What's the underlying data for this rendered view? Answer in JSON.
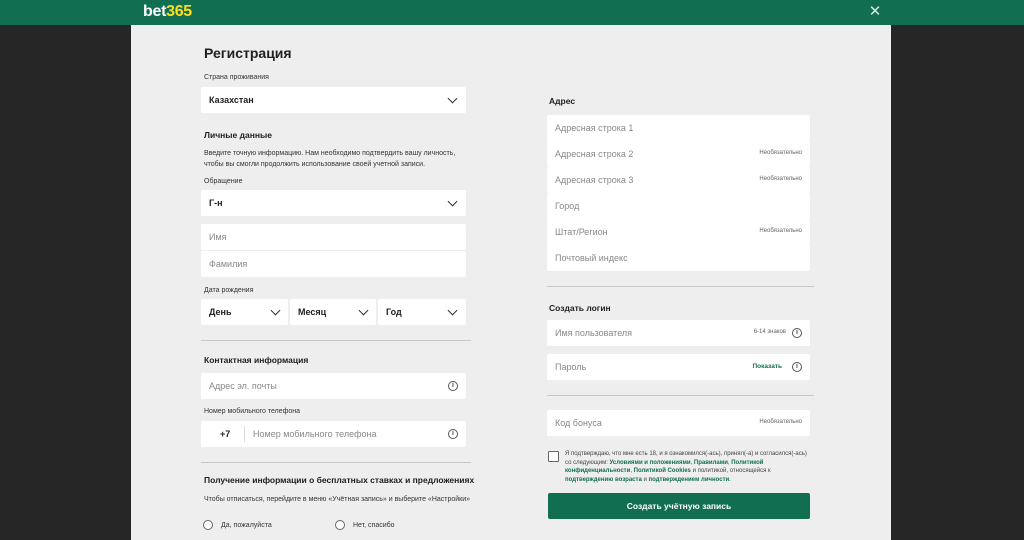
{
  "header": {
    "logo_part1": "bet",
    "logo_part2": "365",
    "close_glyph": "✕"
  },
  "form": {
    "title": "Регистрация",
    "country": {
      "label": "Страна проживания",
      "value": "Казахстан"
    },
    "personal": {
      "heading": "Личные данные",
      "description_line1": "Введите точную информацию. Нам необходимо подтвердить вашу личность,",
      "description_line2": "чтобы вы смогли продолжить использование своей учетной записи.",
      "salutation_label": "Обращение",
      "salutation_value": "Г-н",
      "first_name_placeholder": "Имя",
      "last_name_placeholder": "Фамилия",
      "dob_label": "Дата рождения",
      "day": "День",
      "month": "Месяц",
      "year": "Год"
    },
    "contact": {
      "heading": "Контактная информация",
      "email_placeholder": "Адрес эл. почты",
      "phone_label": "Номер мобильного телефона",
      "phone_code": "+7",
      "phone_placeholder": "Номер мобильного телефона"
    },
    "offers": {
      "heading": "Получение информации о бесплатных ставках и предложениях",
      "description": "Чтобы отписаться, перейдите в меню «Учётная запись» и выберите «Настройки»",
      "yes": "Да, пожалуйста",
      "no": "Нет, спасибо"
    },
    "address": {
      "heading": "Адрес",
      "line1": "Адресная строка 1",
      "line2": "Адресная строка 2",
      "line3": "Адресная строка 3",
      "city": "Город",
      "state": "Штат/Регион",
      "postcode": "Почтовый индекс",
      "optional": "Необязательно"
    },
    "login": {
      "heading": "Создать логин",
      "username_placeholder": "Имя пользователя",
      "username_hint": "6-14 знаков",
      "password_placeholder": "Пароль",
      "show_label": "Показать"
    },
    "bonus": {
      "placeholder": "Код бонуса",
      "optional": "Необязательно"
    },
    "terms": {
      "t1": "Я подтверждаю, что мне есть 18, и я ознакомился(-ась), принял(-а) и согласился(-ась) со",
      "t2": "следующим: ",
      "l1": "Условиями и положениями",
      "t3": ", ",
      "l2": "Правилами",
      "t4": ", ",
      "l3": "Политикой",
      "l3b": "конфиденциальности",
      "t5": ", ",
      "l4": "Политикой Cookies",
      "t6": " и политикой, относящейся к ",
      "l5": "подтверждению",
      "l5b": "возраста",
      "t7": " и ",
      "l6": "подтверждением личности",
      "t8": "."
    },
    "submit_label": "Создать учётную запись"
  },
  "colors": {
    "brand_green": "#126e51",
    "logo_yellow": "#ffdf1b",
    "panel_bg": "#eeeeee",
    "backdrop": "#262626"
  }
}
